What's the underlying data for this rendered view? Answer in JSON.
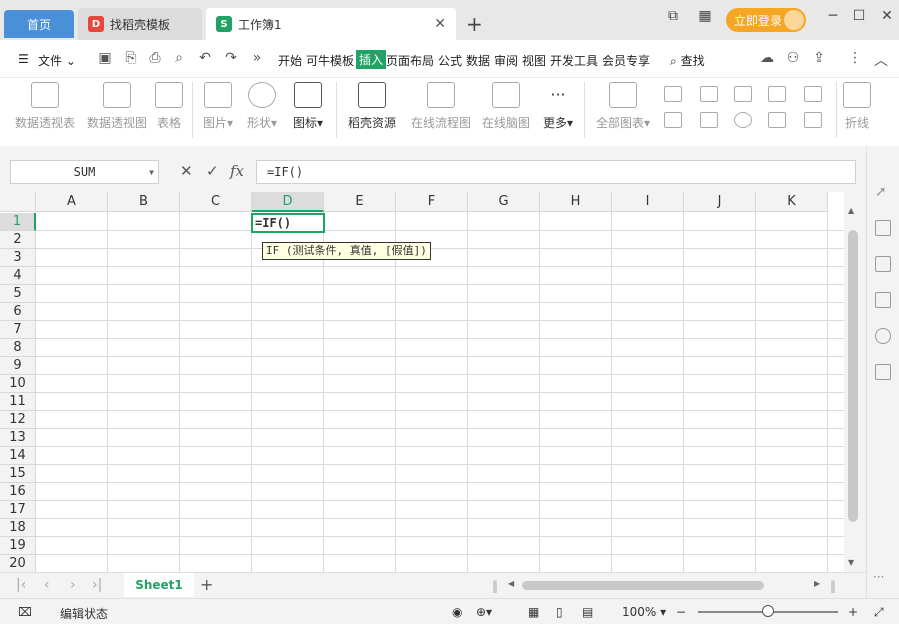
{
  "tabs": {
    "home": "首页",
    "template": "找稻壳模板",
    "workbook": "工作簿1",
    "login": "立即登录"
  },
  "menu": {
    "file": "文件",
    "items": [
      "开始",
      "可牛模板",
      "插入",
      "页面布局",
      "公式",
      "数据",
      "审阅",
      "视图",
      "开发工具",
      "会员专享"
    ],
    "active": "插入",
    "search": "查找"
  },
  "ribbon": {
    "pivot_table": "数据透视表",
    "pivot_chart": "数据透视图",
    "table": "表格",
    "picture": "图片",
    "shape": "形状",
    "icon": "图标",
    "daoke": "稻壳资源",
    "flowchart": "在线流程图",
    "mindmap": "在线脑图",
    "more": "更多",
    "all_charts": "全部图表",
    "line": "折线"
  },
  "formula_bar": {
    "name_box": "SUM",
    "formula": "=IF()"
  },
  "grid": {
    "columns": [
      "A",
      "B",
      "C",
      "D",
      "E",
      "F",
      "G",
      "H",
      "I",
      "J",
      "K"
    ],
    "rows": [
      "1",
      "2",
      "3",
      "4",
      "5",
      "6",
      "7",
      "8",
      "9",
      "10",
      "11",
      "12",
      "13",
      "14",
      "15",
      "16",
      "17",
      "18",
      "19",
      "20"
    ],
    "active_col": "D",
    "active_row": "1",
    "active_cell_value": "=IF()",
    "tooltip": "IF (测试条件, 真值, [假值])"
  },
  "sheets": {
    "current": "Sheet1"
  },
  "status": {
    "mode": "编辑状态",
    "zoom": "100%"
  },
  "colors": {
    "accent": "#21a366",
    "home_tab": "#4a90d9",
    "login": "#f5a623"
  }
}
